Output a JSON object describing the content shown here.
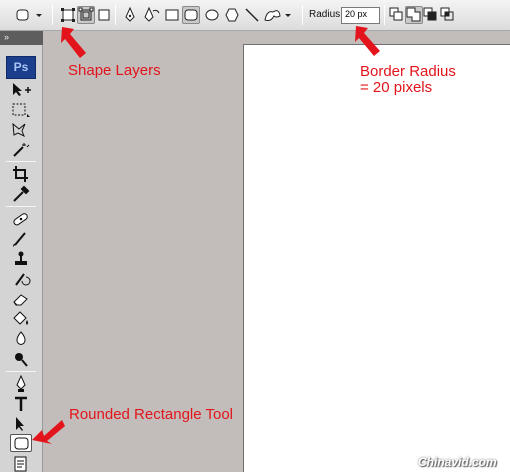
{
  "options_bar": {
    "radius_label": "Radius:",
    "radius_value": "20 px"
  },
  "toolbar": {
    "app_logo": "Ps",
    "collapse_glyph": "»"
  },
  "annotations": {
    "shape_layers": "Shape Layers",
    "border_radius_line1": "Border Radius",
    "border_radius_line2": "= 20 pixels",
    "rounded_rect_tool": "Rounded Rectangle Tool",
    "annotation_color": "#e3141b"
  },
  "watermark": "Chinavid.com"
}
